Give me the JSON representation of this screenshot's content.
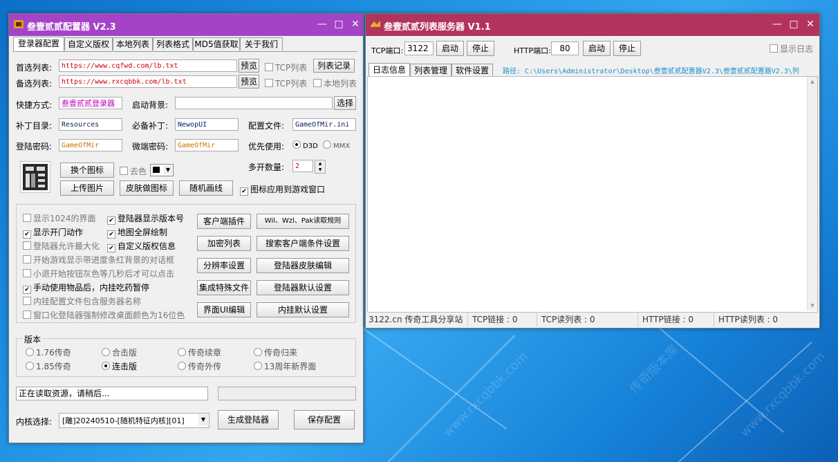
{
  "colors": {
    "left_title": "#a543c6",
    "right_title": "#b2345c",
    "path_color": "#1a8fd0"
  },
  "left": {
    "title": "叁壹贰贰配置器 V2.3",
    "tabs": [
      "登录器配置",
      "自定义版权",
      "本地列表",
      "列表格式",
      "MD5值获取",
      "关于我们"
    ],
    "first_list_label": "首选列表:",
    "first_list_value": "https://www.cqfwd.com/lb.txt",
    "backup_list_label": "备选列表:",
    "backup_list_value": "https://www.rxcqbbk.com/lb.txt",
    "preview_label": "预览",
    "tcp_list_label": "TCP列表",
    "list_record_label": "列表记录",
    "local_list_label": "本地列表",
    "shortcut_label": "快捷方式:",
    "shortcut_value": "叁壹贰贰登录器",
    "bg_label": "启动背景:",
    "bg_value": "",
    "select_label": "选择",
    "patch_dir_label": "补丁目录:",
    "patch_dir_value": "Resources",
    "required_patch_label": "必备补丁:",
    "required_patch_value": "NewopUI",
    "config_file_label": "配置文件:",
    "config_file_value": "GameOfMir.ini",
    "login_pwd_label": "登陆密码:",
    "login_pwd_value": "GameOfMir",
    "micro_pwd_label": "微端密码:",
    "micro_pwd_value": "GameOfMir",
    "priority_label": "优先使用:",
    "d3d_label": "D3D",
    "mmx_label": "MMX",
    "change_icon_label": "换个图标",
    "remove_color_label": "去色",
    "multi_open_label": "多开数量:",
    "multi_open_value": "2",
    "upload_image_label": "上传图片",
    "skin_icon_label": "皮肤做图标",
    "random_line_label": "随机画线",
    "icon_apply_label": "图标应用到游戏窗口",
    "checkboxes": [
      {
        "label": "显示1024的界面",
        "checked": false
      },
      {
        "label": "登陆器显示版本号",
        "checked": true
      },
      {
        "label": "显示开门动作",
        "checked": true
      },
      {
        "label": "地图全屏绘制",
        "checked": true
      },
      {
        "label": "登陆器允许最大化",
        "checked": false
      },
      {
        "label": "自定义版权信息",
        "checked": true
      },
      {
        "label": "开始游戏显示带进度条红背景的对话框",
        "checked": false
      },
      {
        "label": "小退开始按钮灰色等几秒后才可以点击",
        "checked": false
      },
      {
        "label": "手动使用物品后，内挂吃药暂停",
        "checked": true
      },
      {
        "label": "内挂配置文件包含服务器名称",
        "checked": false
      },
      {
        "label": "窗口化登陆器强制修改桌面颜色为16位色",
        "checked": false
      }
    ],
    "right_buttons": [
      [
        "客户端插件",
        "Wil、Wzl、Pak读取规则"
      ],
      [
        "加密列表",
        "搜索客户端条件设置"
      ],
      [
        "分辨率设置",
        "登陆器皮肤编辑"
      ],
      [
        "集成特殊文件",
        "登陆器默认设置"
      ],
      [
        "界面UI编辑",
        "内挂默认设置"
      ]
    ],
    "version_label": "版本",
    "versions": [
      {
        "label": "1.76传奇",
        "selected": false
      },
      {
        "label": "合击版",
        "selected": false
      },
      {
        "label": "传奇续章",
        "selected": false
      },
      {
        "label": "传奇归来",
        "selected": false
      },
      {
        "label": "1.85传奇",
        "selected": false
      },
      {
        "label": "连击版",
        "selected": true
      },
      {
        "label": "传奇外传",
        "selected": false
      },
      {
        "label": "13周年新界面",
        "selected": false
      }
    ],
    "status_text": "正在读取资源，请稍后...",
    "core_label": "内核选择:",
    "core_value": "[雕]20240510-[随机特征内核][01]",
    "generate_label": "生成登陆器",
    "save_label": "保存配置"
  },
  "right": {
    "title": "叁壹贰贰列表服务器 V1.1",
    "tcp_port_label": "TCP端口:",
    "tcp_port_value": "3122",
    "start_label": "启动",
    "stop_label": "停止",
    "http_port_label": "HTTP端口:",
    "http_port_value": "80",
    "show_log_label": "显示日志",
    "tabs": [
      "日志信息",
      "列表管理",
      "软件设置"
    ],
    "path_text": "路径: C:\\Users\\Administrator\\Desktop\\叁壹贰贰配置器V2.3\\叁壹贰贰配置器V2.3\\列",
    "status": [
      "3122.cn 传奇工具分享站",
      "TCP链接 : 0",
      "TCP读列表 : 0",
      "HTTP链接 : 0",
      "HTTP读列表 : 0"
    ]
  }
}
